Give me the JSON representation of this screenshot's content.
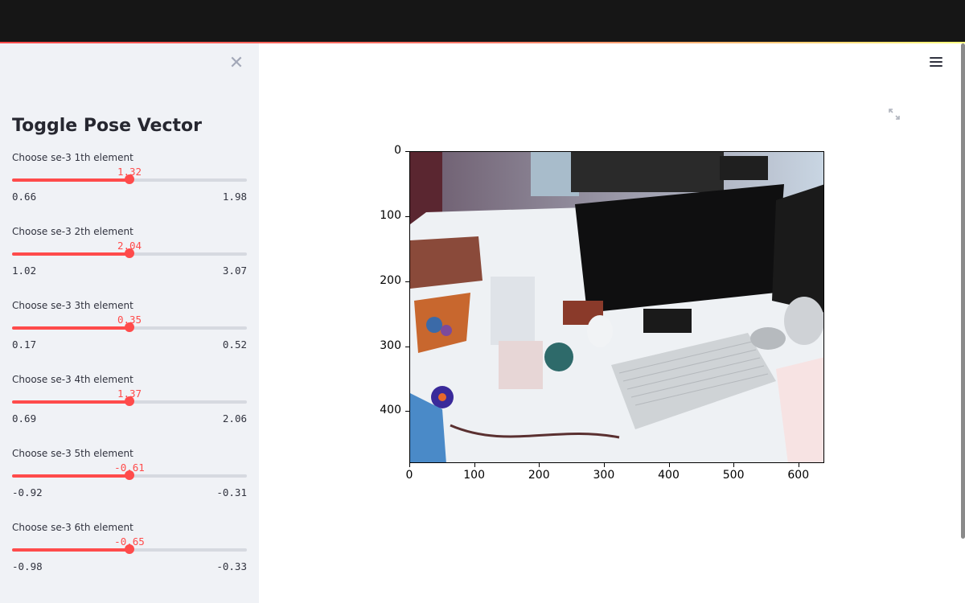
{
  "sidebar": {
    "close_icon": "close-icon",
    "title": "Toggle Pose Vector",
    "sliders": [
      {
        "label": "Choose se-3 1th element",
        "value": "1.32",
        "min": "0.66",
        "max": "1.98",
        "fraction": 0.5
      },
      {
        "label": "Choose se-3 2th element",
        "value": "2.04",
        "min": "1.02",
        "max": "3.07",
        "fraction": 0.5
      },
      {
        "label": "Choose se-3 3th element",
        "value": "0.35",
        "min": "0.17",
        "max": "0.52",
        "fraction": 0.5
      },
      {
        "label": "Choose se-3 4th element",
        "value": "1.37",
        "min": "0.69",
        "max": "2.06",
        "fraction": 0.5
      },
      {
        "label": "Choose se-3 5th element",
        "value": "-0.61",
        "min": "-0.92",
        "max": "-0.31",
        "fraction": 0.5
      },
      {
        "label": "Choose se-3 6th element",
        "value": "-0.65",
        "min": "-0.98",
        "max": "-0.33",
        "fraction": 0.5
      }
    ]
  },
  "main": {
    "menu_icon": "hamburger-menu-icon",
    "expand_icon": "fullscreen-expand-icon",
    "image": {
      "x_ticks": [
        "0",
        "100",
        "200",
        "300",
        "400",
        "500",
        "600"
      ],
      "y_ticks": [
        "0",
        "100",
        "200",
        "300",
        "400"
      ],
      "x_range": [
        0,
        640
      ],
      "y_range": [
        0,
        480
      ]
    }
  },
  "colors": {
    "accent": "#ff4b4b",
    "sidebar_bg": "#f0f2f6",
    "topbar_bg": "#161616"
  }
}
